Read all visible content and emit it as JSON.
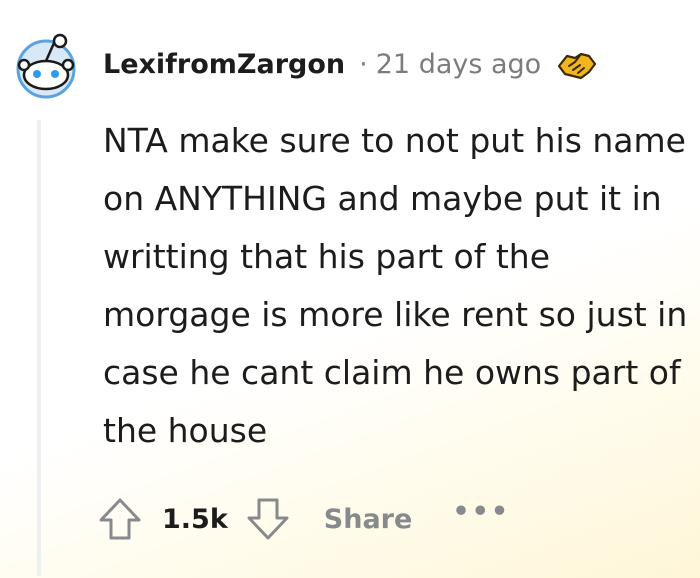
{
  "comment": {
    "author": "LexifromZargon",
    "separator": "·",
    "timestamp": "21 days ago",
    "award_icon": "handshake-award-icon",
    "body": "NTA make sure to not put his name on ANYTHING and maybe put it in writting that his part of the morgage is more like rent so just in case he cant claim he owns part of the house"
  },
  "actions": {
    "score": "1.5k",
    "share_label": "Share",
    "more_label": "•••",
    "upvote_icon": "upvote-arrow-icon",
    "downvote_icon": "downvote-arrow-icon"
  },
  "colors": {
    "text": "#1c1c1c",
    "muted": "#7c7c7c",
    "action_gray": "#878a8c",
    "avatar_blue": "#2d9bf5",
    "award_gold": "#f2b51d"
  }
}
